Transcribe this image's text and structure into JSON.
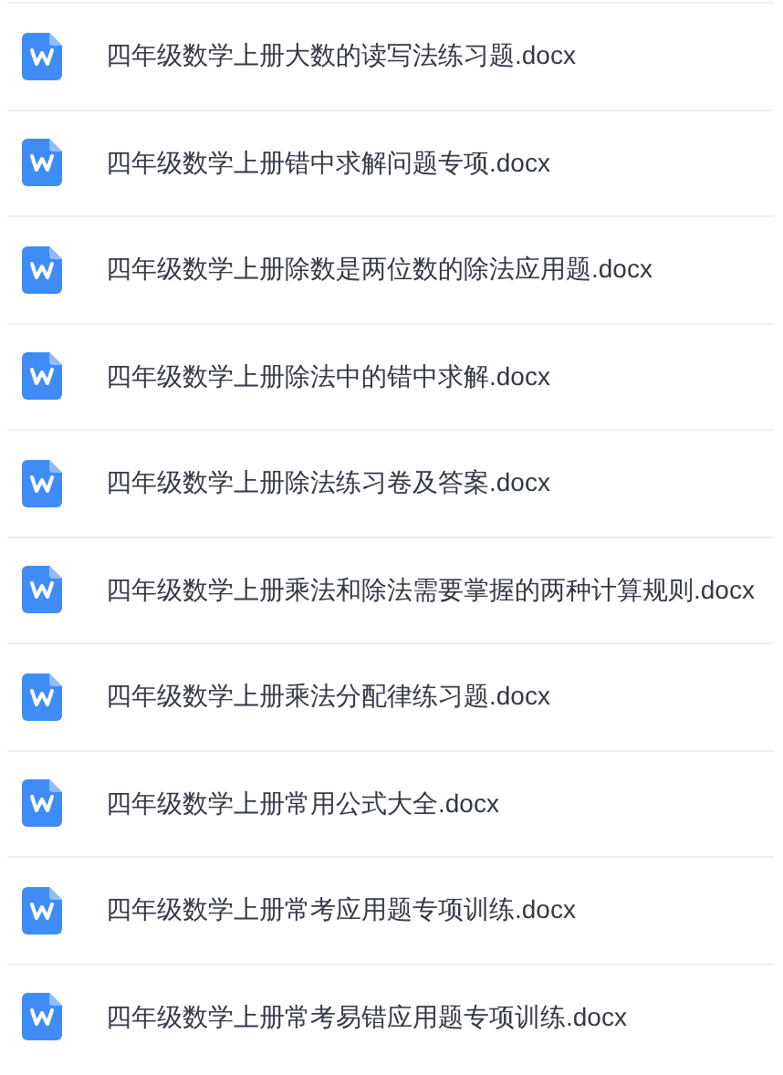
{
  "files": [
    {
      "name": "四年级数学上册大数的读写法练习题.docx"
    },
    {
      "name": "四年级数学上册错中求解问题专项.docx"
    },
    {
      "name": "四年级数学上册除数是两位数的除法应用题.docx"
    },
    {
      "name": "四年级数学上册除法中的错中求解.docx"
    },
    {
      "name": "四年级数学上册除法练习卷及答案.docx"
    },
    {
      "name": "四年级数学上册乘法和除法需要掌握的两种计算规则.docx"
    },
    {
      "name": "四年级数学上册乘法分配律练习题.docx"
    },
    {
      "name": "四年级数学上册常用公式大全.docx"
    },
    {
      "name": "四年级数学上册常考应用题专项训练.docx"
    },
    {
      "name": "四年级数学上册常考易错应用题专项训练.docx"
    }
  ]
}
